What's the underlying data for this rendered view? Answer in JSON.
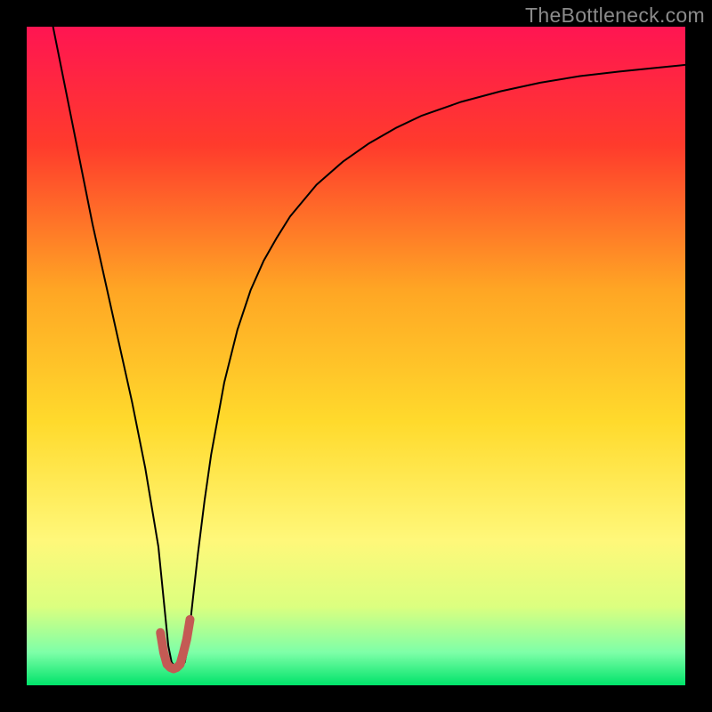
{
  "attribution": "TheBottleneck.com",
  "chart_data": {
    "type": "line",
    "title": "",
    "xlabel": "",
    "ylabel": "",
    "xlim": [
      0,
      100
    ],
    "ylim": [
      0,
      100
    ],
    "grid": false,
    "legend": false,
    "gradient_stops": [
      {
        "pct": 0,
        "color": "#ff1552"
      },
      {
        "pct": 18,
        "color": "#ff3b2c"
      },
      {
        "pct": 40,
        "color": "#ffa624"
      },
      {
        "pct": 60,
        "color": "#ffda2c"
      },
      {
        "pct": 78,
        "color": "#fff87a"
      },
      {
        "pct": 88,
        "color": "#dcff7f"
      },
      {
        "pct": 95,
        "color": "#7effa8"
      },
      {
        "pct": 100,
        "color": "#00e36a"
      }
    ],
    "series": [
      {
        "name": "black-curve",
        "color": "#000000",
        "stroke_width": 2,
        "x": [
          4,
          6,
          8,
          10,
          12,
          14,
          16,
          18,
          19,
          20,
          20.5,
          21,
          21.5,
          22,
          22.5,
          23,
          23.5,
          24,
          24.5,
          25,
          26,
          27,
          28,
          30,
          32,
          34,
          36,
          38,
          40,
          44,
          48,
          52,
          56,
          60,
          66,
          72,
          78,
          84,
          90,
          96,
          100
        ],
        "y": [
          100,
          90,
          80,
          70,
          61,
          52,
          43,
          33,
          27,
          21,
          16,
          11,
          6,
          3.5,
          2.8,
          2.6,
          2.8,
          3.5,
          6,
          11,
          20,
          28,
          35,
          46,
          54,
          60,
          64.5,
          68,
          71.2,
          76,
          79.5,
          82.3,
          84.6,
          86.5,
          88.6,
          90.2,
          91.5,
          92.5,
          93.2,
          93.8,
          94.2
        ]
      },
      {
        "name": "red-marker-curve",
        "color": "#c45a54",
        "stroke_width": 10,
        "x": [
          20.3,
          20.8,
          21.3,
          21.8,
          22.3,
          22.8,
          23.3,
          23.8,
          24.3,
          24.8
        ],
        "y": [
          8,
          5,
          3.2,
          2.7,
          2.5,
          2.7,
          3.2,
          5,
          7,
          10
        ]
      }
    ]
  }
}
